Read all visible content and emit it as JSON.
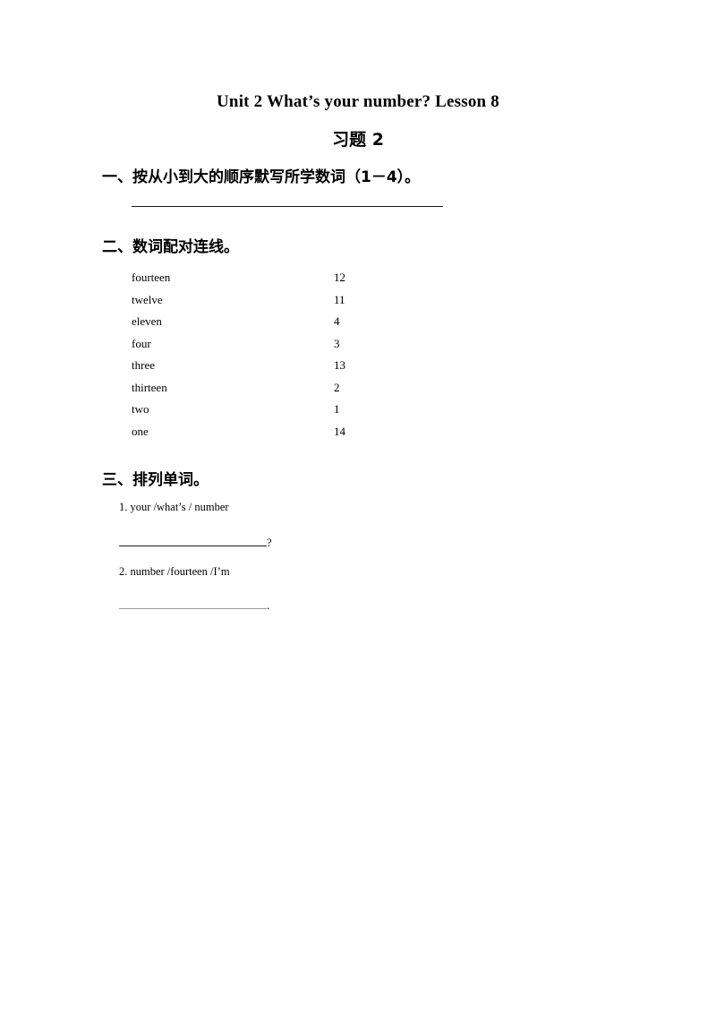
{
  "document": {
    "title": "Unit 2 What’s your number? Lesson 8",
    "subtitle": "习题 2"
  },
  "sections": [
    {
      "heading": "一、按从小到大的顺序默写所学数词（1－4）。",
      "answer_line": ""
    },
    {
      "heading": "二、数词配对连线。",
      "pairs": [
        {
          "word": "fourteen",
          "number": "12"
        },
        {
          "word": "twelve",
          "number": "11"
        },
        {
          "word": "eleven",
          "number": "4"
        },
        {
          "word": "four",
          "number": "3"
        },
        {
          "word": "three",
          "number": "13"
        },
        {
          "word": "thirteen",
          "number": "2"
        },
        {
          "word": "two",
          "number": "1"
        },
        {
          "word": "one",
          "number": "14"
        }
      ]
    },
    {
      "heading": "三、排列单词。",
      "items": [
        {
          "prompt": "1. your /what’s / number",
          "answer": "",
          "punctuation": "?"
        },
        {
          "prompt": "2. number /fourteen /I’m",
          "answer": "",
          "punctuation": "."
        }
      ]
    }
  ]
}
